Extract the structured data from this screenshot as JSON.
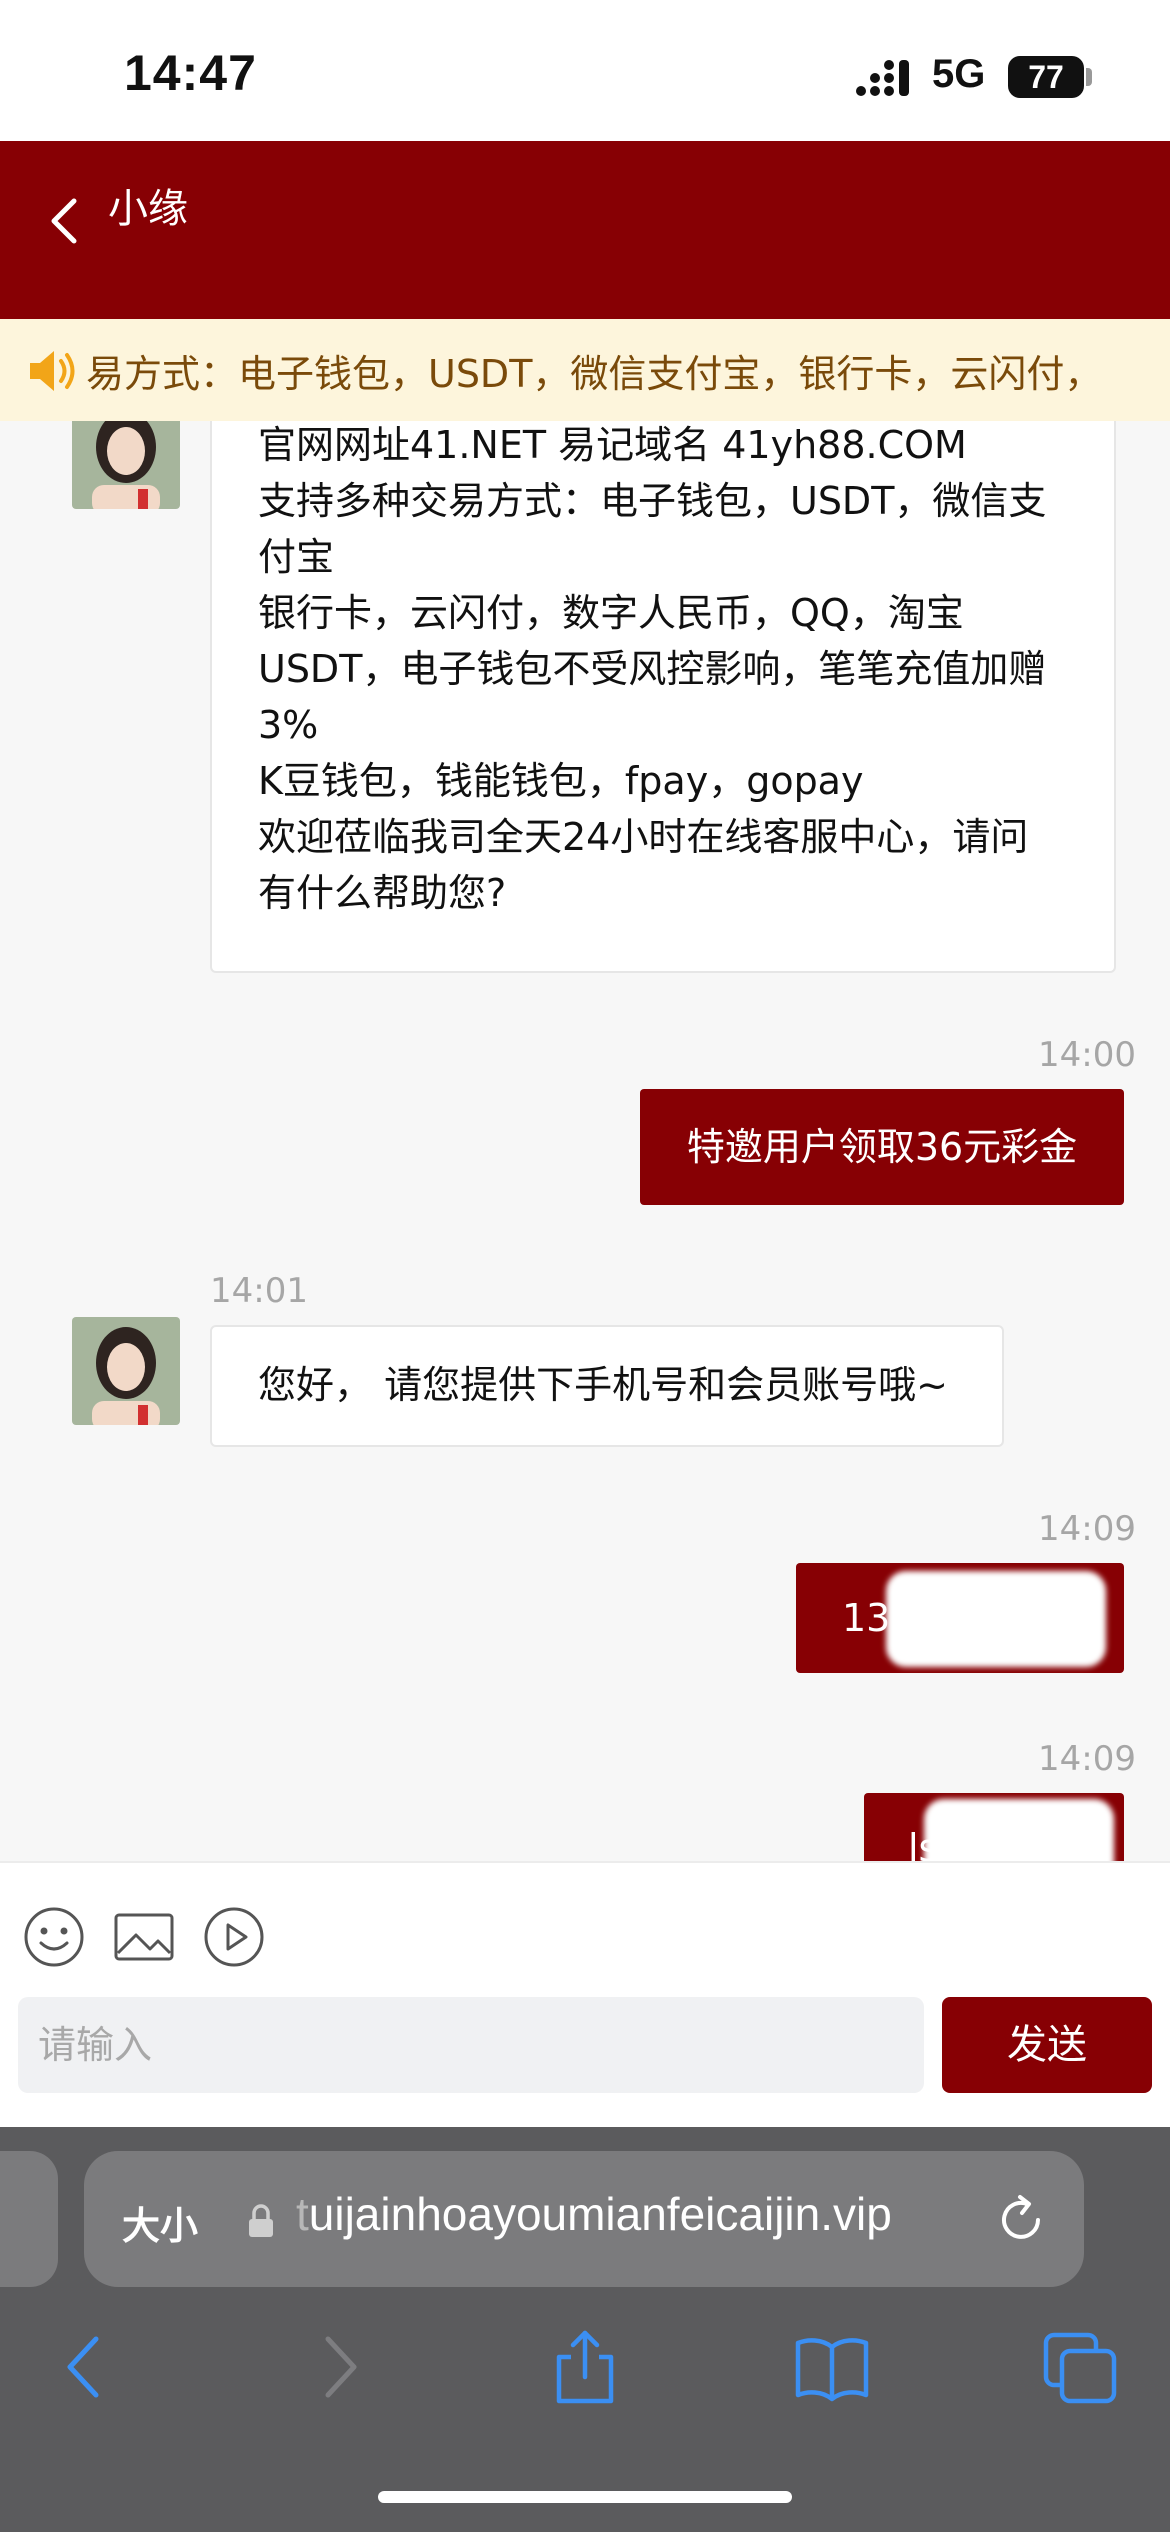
{
  "status_bar": {
    "time": "14:47",
    "network": "5G",
    "battery": "77"
  },
  "header": {
    "title": "小缘"
  },
  "notice": {
    "text": "易方式：电子钱包，USDT，微信支付宝，银行卡，云闪付，"
  },
  "messages": {
    "intro_lines": [
      "官网网址41.NET 易记域名 41yh88.COM",
      "支持多种交易方式：电子钱包，USDT，微信支",
      "付宝",
      "银行卡，云闪付，数字人民币，QQ，淘宝",
      "USDT，电子钱包不受风控影响，笔笔充值加赠",
      "3%",
      "K豆钱包，钱能钱包，fpay，gopay",
      "欢迎莅临我司全天24小时在线客服中心，请问",
      "有什么帮助您?"
    ],
    "out1_time": "14:00",
    "out1_text": "特邀用户领取36元彩金",
    "in2_time": "14:01",
    "in2_text": "您好， 请您提供下手机号和会员账号哦~",
    "out2_time": "14:09",
    "out2_text": "13",
    "out3_time": "14:09",
    "out3_text": "ls"
  },
  "input": {
    "placeholder": "请输入",
    "send_label": "发送"
  },
  "browser": {
    "aa_label": "大小",
    "url_dim": "t",
    "url": "uijainhoayoumianfeicaijin.vip"
  },
  "colors": {
    "brand": "#870004",
    "notice_bg": "#fdf5dc",
    "browser_bg": "#5b5b5d"
  }
}
